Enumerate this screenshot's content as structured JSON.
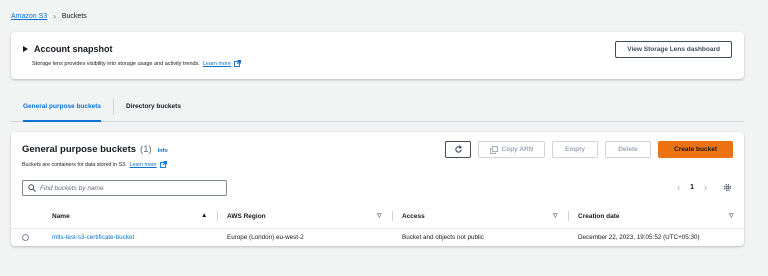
{
  "breadcrumb": {
    "root": "Amazon S3",
    "current": "Buckets"
  },
  "snapshot": {
    "title": "Account snapshot",
    "description": "Storage lens provides visibility into storage usage and activity trends.",
    "learn_more": "Learn more",
    "dashboard_button": "View Storage Lens dashboard"
  },
  "tabs": [
    {
      "label": "General purpose buckets",
      "active": true
    },
    {
      "label": "Directory buckets",
      "active": false
    }
  ],
  "panel": {
    "title": "General purpose buckets",
    "count": "(1)",
    "info": "Info",
    "description": "Buckets are containers for data stored in S3.",
    "learn_more": "Learn more",
    "actions": {
      "copy_arn": "Copy ARN",
      "empty": "Empty",
      "delete": "Delete",
      "create": "Create bucket"
    },
    "search": {
      "placeholder": "Find buckets by name"
    },
    "pagination": {
      "current_page": "1"
    }
  },
  "table": {
    "columns": [
      "Name",
      "AWS Region",
      "Access",
      "Creation date"
    ],
    "rows": [
      {
        "name": "mtls-test-s3-certificate-bucket",
        "region": "Europe (London) eu-west-2",
        "access": "Bucket and objects not public",
        "created": "December 22, 2023, 19:05:52 (UTC+05:30)"
      }
    ]
  },
  "colors": {
    "link": "#0972d3",
    "primary": "#ec7211",
    "background": "#f2f3f3"
  }
}
